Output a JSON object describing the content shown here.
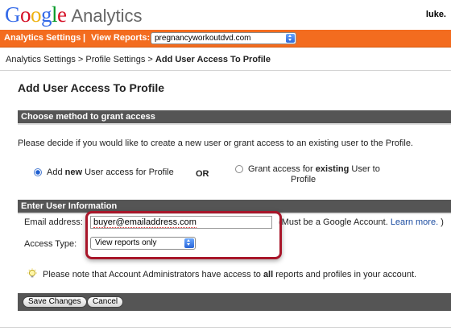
{
  "header": {
    "logo_google": [
      "G",
      "o",
      "o",
      "g",
      "l",
      "e"
    ],
    "logo_product": "Analytics",
    "user": "luke."
  },
  "nav": {
    "settings_label": "Analytics Settings",
    "separator": "|",
    "view_reports_label": "View Reports:",
    "profile_selected": "pregnancyworkoutdvd.com"
  },
  "breadcrumb": {
    "item1": "Analytics Settings",
    "sep": " > ",
    "item2": "Profile Settings",
    "current": "Add User Access To Profile"
  },
  "page": {
    "title": "Add User Access To Profile"
  },
  "method": {
    "heading": "Choose method to grant access",
    "description": "Please decide if you would like to create a new user or grant access to an existing user to the Profile.",
    "option_new_prefix": "Add ",
    "option_new_bold": "new",
    "option_new_suffix": " User access for Profile",
    "or_label": "OR",
    "option_existing_prefix": "Grant access for ",
    "option_existing_bold": "existing",
    "option_existing_suffix": " User to",
    "option_existing_line2": "Profile",
    "selected": "new"
  },
  "user_info": {
    "heading": "Enter User Information",
    "email_label": "Email address:",
    "email_value": "buyer@emailaddress.com",
    "email_hint_prefix": "(Must be a Google Account.",
    "learn_more": "Learn more.",
    "email_hint_suffix": ")",
    "access_label": "Access Type:",
    "access_selected": "View reports only"
  },
  "tip": {
    "prefix": "Please note that Account Administrators have access to ",
    "bold": "all",
    "suffix": " reports and profiles in your account."
  },
  "actions": {
    "save_label": "Save Changes",
    "cancel_label": "Cancel"
  },
  "colors": {
    "orange_bar": "#f36c1f",
    "section_bar": "#555555",
    "highlight": "#a8162a",
    "link": "#1a4ba0"
  }
}
